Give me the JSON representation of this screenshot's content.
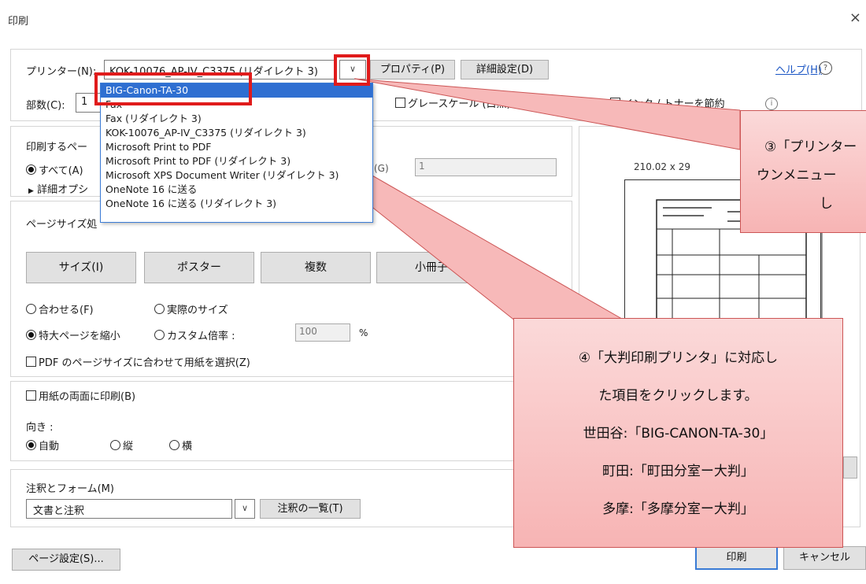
{
  "window": {
    "title": "印刷",
    "close_glyph": "×"
  },
  "printer": {
    "label": "プリンター(N):",
    "selected": "KOK-10076_AP-IV_C3375 (リダイレクト 3)",
    "properties_btn": "プロパティ(P)",
    "advanced_btn": "詳細設定(D)",
    "help_link": "ヘルプ(H)",
    "help_icon": "?"
  },
  "copies": {
    "label": "部数(C):",
    "value": "1"
  },
  "options_row": {
    "grayscale": "グレースケール (白黒) で印刷(Y)",
    "save_ink": "インク / トナーを節約",
    "info_icon": "i"
  },
  "dropdown": {
    "items": [
      "BIG-Canon-TA-30",
      "Fax",
      "Fax (リダイレクト 3)",
      "KOK-10076_AP-IV_C3375 (リダイレクト 3)",
      "Microsoft Print to PDF",
      "Microsoft Print to PDF (リダイレクト 3)",
      "Microsoft XPS Document Writer (リダイレクト 3)",
      "OneNote 16 に送る",
      "OneNote 16 に送る (リダイレクト 3)"
    ]
  },
  "pages": {
    "heading": "印刷するペー",
    "all": "すべて(A)",
    "more": "詳細オプシ",
    "pages_suffix": "(G)",
    "pages_value": "1"
  },
  "size_section": {
    "heading": "ページサイズ処",
    "buttons": [
      "サイズ(I)",
      "ポスター",
      "複数",
      "小冊子"
    ],
    "fit": "合わせる(F)",
    "actual": "実際のサイズ",
    "shrink": "特大ページを縮小",
    "custom": "カスタム倍率 :",
    "custom_value": "100",
    "percent": "%",
    "paper_by_pdf": "PDF のページサイズに合わせて用紙を選択(Z)"
  },
  "duplex": {
    "label": "用紙の両面に印刷(B)"
  },
  "orientation": {
    "label": "向き :",
    "auto": "自動",
    "portrait": "縦",
    "landscape": "横"
  },
  "annotations": {
    "label": "注釈とフォーム(M)",
    "value": "文書と注釈",
    "summary_btn": "注釈の一覧(T)"
  },
  "preview": {
    "size_text": "210.02 x 29"
  },
  "footer": {
    "page_setup": "ページ設定(S)...",
    "print": "印刷",
    "cancel": "キャンセル"
  },
  "callout3": {
    "lines": [
      "③「プリンター",
      "ウンメニュー",
      "し"
    ]
  },
  "callout4": {
    "lines": [
      "④「大判印刷プリンタ」に対応し",
      "た項目をクリックします。",
      "世田谷:「BIG-CANON-TA-30」",
      "町田:「町田分室ー大判」",
      "多摩:「多摩分室ー大判」"
    ]
  }
}
